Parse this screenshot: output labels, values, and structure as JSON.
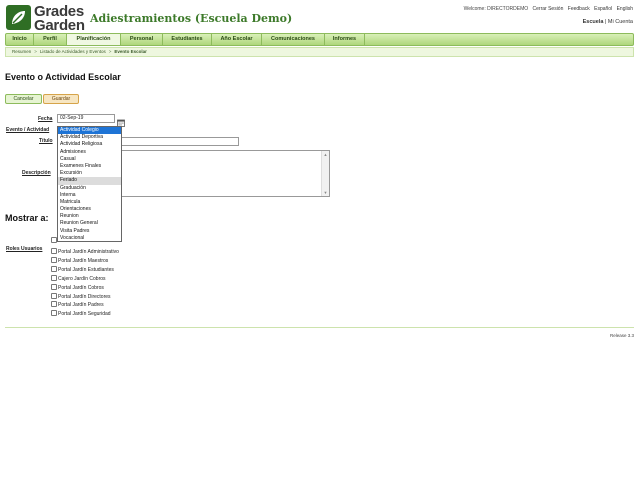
{
  "brand": {
    "line1": "Grades",
    "line2": "Garden"
  },
  "app_title": "Adiestramientos (Escuela Demo)",
  "topbar": {
    "welcome": "Welcome: DIRECTORDEMO",
    "logout": "Cerrar Sesión",
    "feedback": "Feedback",
    "lang_es": "Español",
    "lang_en": "English",
    "school": "Escuela",
    "separator": "|",
    "account": "Mi Cuenta"
  },
  "nav": {
    "items": [
      "Inicio",
      "Perfil",
      "Planificación",
      "Personal",
      "Estudiantes",
      "Año Escolar",
      "Comunicaciones",
      "Informes"
    ],
    "active_index": 2
  },
  "breadcrumb": {
    "items": [
      "Resumen",
      "Listado de Actividades y Eventos",
      "Evento Escolar"
    ],
    "separator": ">"
  },
  "page_title": "Evento o Actividad Escolar",
  "buttons": {
    "cancel": "Cancelar",
    "save": "Guardar"
  },
  "form": {
    "date_label": "Fecha",
    "date_value": "02-Sep-19",
    "event_label": "Evento / Actividad",
    "title_label": "Título",
    "description_label": "Descripción",
    "event_options": [
      "Actividad Colegio",
      "Actividad Deportiva",
      "Actividad Religiosa",
      "Admisiones",
      "Casual",
      "Examenes Finales",
      "Excursión",
      "Feriado",
      "Graduación",
      "Interna",
      "Matricula",
      "Orientaciones",
      "Reunion",
      "Reunion General",
      "Visita Padres",
      "Vocacional"
    ],
    "selected_option": "Actividad Colegio",
    "hovered_option": "Feriado"
  },
  "show_section": {
    "title": "Mostrar a:",
    "roles_label": "Roles Usuarios",
    "roles": [
      "Portal Jardín Administrativo",
      "Portal Jardín Maestros",
      "Portal Jardín Estudiantes",
      "Cajero Jardín Cobros",
      "Portal Jardín Cobros",
      "Portal Jardín Directores",
      "Portal Jardín Padres",
      "Portal Jardín Seguridad"
    ]
  },
  "footer": {
    "release": "Release 3.3"
  },
  "colors": {
    "nav_green": "#aed67c",
    "select_blue": "#1e74d6",
    "brand_green": "#2f6e24"
  },
  "icons": {
    "calendar": "calendar-icon",
    "logo": "leaf-logo-icon"
  }
}
